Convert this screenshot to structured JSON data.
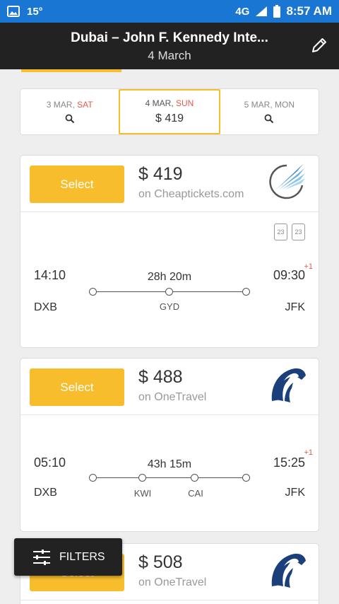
{
  "status_bar": {
    "temperature": "15°",
    "network": "4G",
    "time": "8:57 AM"
  },
  "header": {
    "title": "Dubai – John F. Kennedy Inte...",
    "subtitle": "4 March",
    "edit_icon": "pencil-icon"
  },
  "date_tabs": [
    {
      "date": "3 MAR, ",
      "day": "SAT",
      "price": ""
    },
    {
      "date": "4 MAR, ",
      "day": "SUN",
      "price": "$ 419"
    },
    {
      "date": "5 MAR, MON",
      "day": "",
      "price": ""
    }
  ],
  "results": [
    {
      "select_label": "Select",
      "price": "$ 419",
      "provider": "on Cheaptickets.com",
      "dep_time": "14:10",
      "arr_time": "09:30",
      "day_offset": "+1",
      "duration": "28h 20m",
      "dep_code": "DXB",
      "arr_code": "JFK",
      "stops": [
        "GYD"
      ],
      "bags": [
        "23",
        "23"
      ],
      "logo": "azal-airline-logo"
    },
    {
      "select_label": "Select",
      "price": "$ 488",
      "provider": "on OneTravel",
      "dep_time": "05:10",
      "arr_time": "15:25",
      "day_offset": "+1",
      "duration": "43h 15m",
      "dep_code": "DXB",
      "arr_code": "JFK",
      "stops": [
        "KWI",
        "CAI"
      ],
      "logo": "egyptair-airline-logo"
    },
    {
      "select_label": "Select",
      "price": "$ 508",
      "provider": "on OneTravel",
      "logo": "egyptair-airline-logo"
    }
  ],
  "filters_label": "FILTERS",
  "colors": {
    "accent": "#f7bd2c",
    "header": "#222222",
    "status_bar": "#1976d2",
    "day_red": "#e15a4a"
  }
}
